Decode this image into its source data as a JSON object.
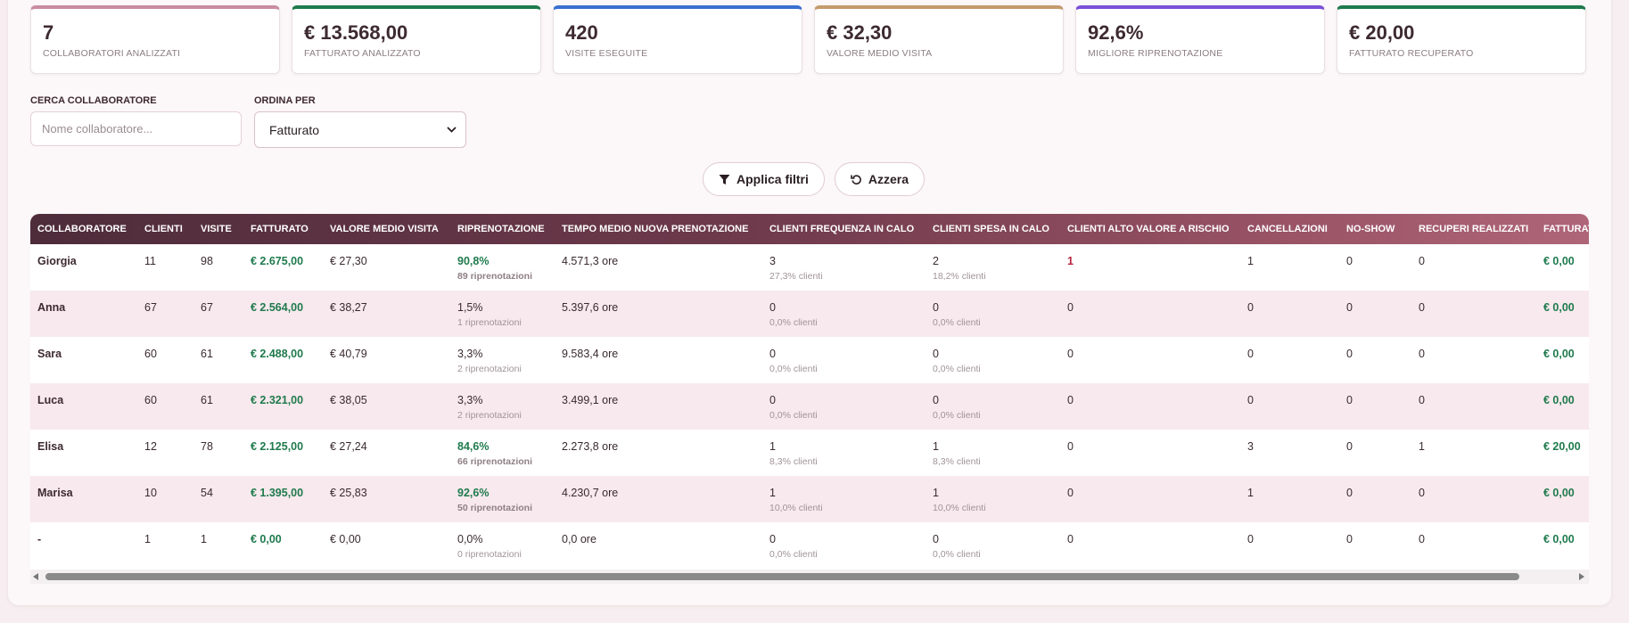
{
  "kpis": [
    {
      "value": "7",
      "label": "Collaboratori analizzati",
      "color": "#c88ca2"
    },
    {
      "value": "€ 13.568,00",
      "label": "Fatturato analizzato",
      "color": "#1f7a4d"
    },
    {
      "value": "420",
      "label": "Visite eseguite",
      "color": "#3a6fd0"
    },
    {
      "value": "€ 32,30",
      "label": "Valore medio visita",
      "color": "#c49a6c"
    },
    {
      "value": "92,6%",
      "label": "Migliore riprenotazione",
      "color": "#7b4fd8"
    },
    {
      "value": "€ 20,00",
      "label": "Fatturato recuperato",
      "color": "#1f7a4d"
    }
  ],
  "filters": {
    "search_label": "Cerca collaboratore",
    "search_placeholder": "Nome collaboratore...",
    "sort_label": "Ordina per",
    "sort_value": "Fatturato"
  },
  "actions": {
    "apply_label": "Applica filtri",
    "reset_label": "Azzera"
  },
  "table": {
    "headers": [
      "Collaboratore",
      "Clienti",
      "Visite",
      "Fatturato",
      "Valore medio visita",
      "Riprenotazione",
      "Tempo medio nuova prenotazione",
      "Clienti frequenza in calo",
      "Clienti spesa in calo",
      "Clienti alto valore a rischio",
      "Cancellazioni",
      "No-show",
      "Recuperi realizzati",
      "Fatturato recuperato"
    ],
    "rows": [
      {
        "name": "Giorgia",
        "clienti": "11",
        "visite": "98",
        "fatturato": "€ 2.675,00",
        "valore": "€ 27,30",
        "rip": "90,8%",
        "rip_sub": "89 riprenotazioni",
        "rip_hi": true,
        "tempo": "4.571,3 ore",
        "freq": "3",
        "freq_sub": "27,3% clienti",
        "spesa": "2",
        "spesa_sub": "18,2% clienti",
        "rischio": "1",
        "rischio_hi": true,
        "canc": "1",
        "noshow": "0",
        "recuperi": "0",
        "fatt_rec": "€ 0,00"
      },
      {
        "name": "Anna",
        "clienti": "67",
        "visite": "67",
        "fatturato": "€ 2.564,00",
        "valore": "€ 38,27",
        "rip": "1,5%",
        "rip_sub": "1 riprenotazioni",
        "rip_hi": false,
        "tempo": "5.397,6 ore",
        "freq": "0",
        "freq_sub": "0,0% clienti",
        "spesa": "0",
        "spesa_sub": "0,0% clienti",
        "rischio": "0",
        "rischio_hi": false,
        "canc": "0",
        "noshow": "0",
        "recuperi": "0",
        "fatt_rec": "€ 0,00"
      },
      {
        "name": "Sara",
        "clienti": "60",
        "visite": "61",
        "fatturato": "€ 2.488,00",
        "valore": "€ 40,79",
        "rip": "3,3%",
        "rip_sub": "2 riprenotazioni",
        "rip_hi": false,
        "tempo": "9.583,4 ore",
        "freq": "0",
        "freq_sub": "0,0% clienti",
        "spesa": "0",
        "spesa_sub": "0,0% clienti",
        "rischio": "0",
        "rischio_hi": false,
        "canc": "0",
        "noshow": "0",
        "recuperi": "0",
        "fatt_rec": "€ 0,00"
      },
      {
        "name": "Luca",
        "clienti": "60",
        "visite": "61",
        "fatturato": "€ 2.321,00",
        "valore": "€ 38,05",
        "rip": "3,3%",
        "rip_sub": "2 riprenotazioni",
        "rip_hi": false,
        "tempo": "3.499,1 ore",
        "freq": "0",
        "freq_sub": "0,0% clienti",
        "spesa": "0",
        "spesa_sub": "0,0% clienti",
        "rischio": "0",
        "rischio_hi": false,
        "canc": "0",
        "noshow": "0",
        "recuperi": "0",
        "fatt_rec": "€ 0,00"
      },
      {
        "name": "Elisa",
        "clienti": "12",
        "visite": "78",
        "fatturato": "€ 2.125,00",
        "valore": "€ 27,24",
        "rip": "84,6%",
        "rip_sub": "66 riprenotazioni",
        "rip_hi": true,
        "tempo": "2.273,8 ore",
        "freq": "1",
        "freq_sub": "8,3% clienti",
        "spesa": "1",
        "spesa_sub": "8,3% clienti",
        "rischio": "0",
        "rischio_hi": false,
        "canc": "3",
        "noshow": "0",
        "recuperi": "1",
        "fatt_rec": "€ 20,00"
      },
      {
        "name": "Marisa",
        "clienti": "10",
        "visite": "54",
        "fatturato": "€ 1.395,00",
        "valore": "€ 25,83",
        "rip": "92,6%",
        "rip_sub": "50 riprenotazioni",
        "rip_hi": true,
        "tempo": "4.230,7 ore",
        "freq": "1",
        "freq_sub": "10,0% clienti",
        "spesa": "1",
        "spesa_sub": "10,0% clienti",
        "rischio": "0",
        "rischio_hi": false,
        "canc": "1",
        "noshow": "0",
        "recuperi": "0",
        "fatt_rec": "€ 0,00"
      },
      {
        "name": "-",
        "clienti": "1",
        "visite": "1",
        "fatturato": "€ 0,00",
        "valore": "€ 0,00",
        "rip": "0,0%",
        "rip_sub": "0 riprenotazioni",
        "rip_hi": false,
        "tempo": "0,0 ore",
        "freq": "0",
        "freq_sub": "0,0% clienti",
        "spesa": "0",
        "spesa_sub": "0,0% clienti",
        "rischio": "0",
        "rischio_hi": false,
        "canc": "0",
        "noshow": "0",
        "recuperi": "0",
        "fatt_rec": "€ 0,00"
      }
    ]
  },
  "icons": {
    "apply": "filter-icon",
    "reset": "reset-icon"
  }
}
